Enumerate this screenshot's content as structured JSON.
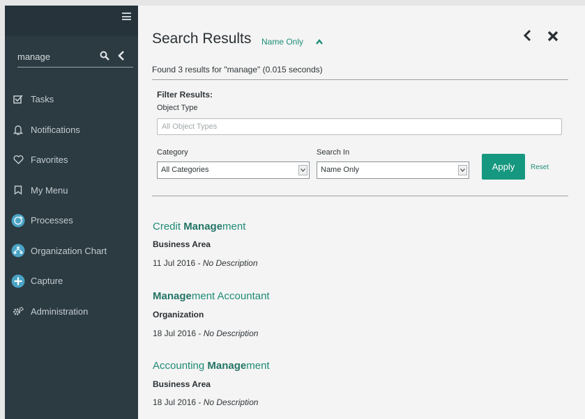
{
  "sidebar": {
    "search_value": "manage",
    "items": [
      {
        "label": "Tasks",
        "icon": "checkbox-icon"
      },
      {
        "label": "Notifications",
        "icon": "bell-icon"
      },
      {
        "label": "Favorites",
        "icon": "heart-icon"
      },
      {
        "label": "My Menu",
        "icon": "bookmark-icon"
      },
      {
        "label": "Processes",
        "icon": "processes-icon"
      },
      {
        "label": "Organization Chart",
        "icon": "org-chart-icon"
      },
      {
        "label": "Capture",
        "icon": "plus-circle-icon"
      },
      {
        "label": "Administration",
        "icon": "gears-icon"
      }
    ]
  },
  "panel": {
    "title": "Search Results",
    "scope": "Name Only",
    "found_text": "Found 3 results for \"manage\" (0.015 seconds)"
  },
  "filter": {
    "title": "Filter Results:",
    "object_type_label": "Object Type",
    "object_type_placeholder": "All Object Types",
    "category_label": "Category",
    "category_value": "All Categories",
    "search_in_label": "Search In",
    "search_in_value": "Name Only",
    "apply_label": "Apply",
    "reset_label": "Reset"
  },
  "results": [
    {
      "pre": "Credit ",
      "match": "Manage",
      "post": "ment",
      "type": "Business Area",
      "date": "11 Jul 2016 - ",
      "desc": "No Description"
    },
    {
      "pre": "",
      "match": "Manage",
      "post": "ment Accountant",
      "type": "Organization",
      "date": "18 Jul 2016 - ",
      "desc": "No Description"
    },
    {
      "pre": "Accounting ",
      "match": "Manage",
      "post": "ment",
      "type": "Business Area",
      "date": "18 Jul 2016 - ",
      "desc": "No Description"
    }
  ],
  "colors": {
    "sidebar_bg": "#2c3a41",
    "accent": "#15987f",
    "link": "#1f8a76"
  }
}
